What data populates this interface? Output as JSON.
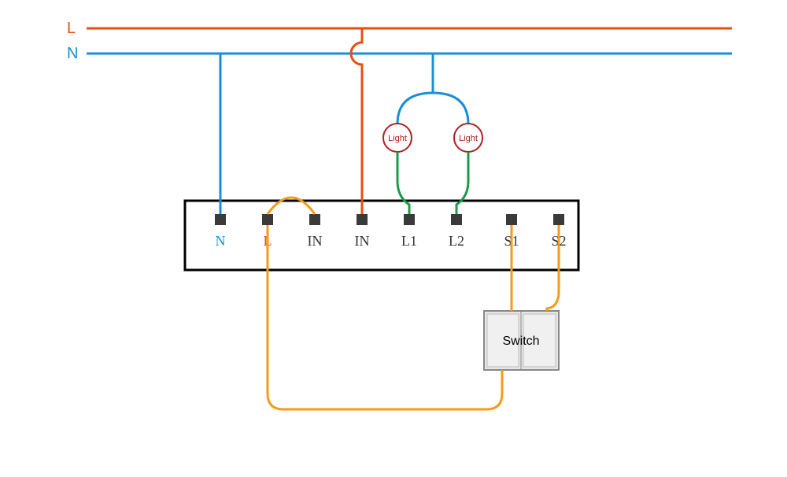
{
  "lines": {
    "L": {
      "label": "L",
      "color": "#e84e10"
    },
    "N": {
      "label": "N",
      "color": "#1a8fd6"
    }
  },
  "lights": {
    "light1": {
      "label": "Light"
    },
    "light2": {
      "label": "Light"
    }
  },
  "terminals": {
    "N": {
      "label": "N",
      "color": "#1a8fd6"
    },
    "L": {
      "label": "L",
      "color": "#e84e10"
    },
    "IN1": {
      "label": "IN",
      "color": "#333333"
    },
    "IN2": {
      "label": "IN",
      "color": "#333333"
    },
    "L1": {
      "label": "L1",
      "color": "#333333"
    },
    "L2": {
      "label": "L2",
      "color": "#333333"
    },
    "S1": {
      "label": "S1",
      "color": "#333333"
    },
    "S2": {
      "label": "S2",
      "color": "#333333"
    }
  },
  "switch": {
    "label": "Switch"
  },
  "colors": {
    "live": "#e84e10",
    "neutral": "#1a8fd6",
    "green": "#1a9a4a",
    "orange": "#f59a1a",
    "box": "#000000",
    "terminal_fill": "#3a3a3a",
    "switch_fill": "#e6e6e6",
    "switch_stroke": "#888888"
  }
}
